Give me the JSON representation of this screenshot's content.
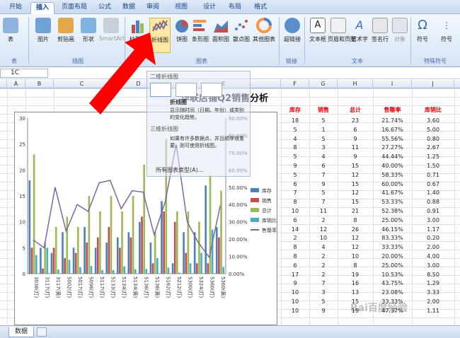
{
  "tabs": [
    "开始",
    "插入",
    "页面布局",
    "公式",
    "数据",
    "审阅",
    "视图",
    "设计",
    "布局",
    "格式"
  ],
  "active_tab": "插入",
  "ribbon": {
    "buttons": [
      {
        "label": "表",
        "icon": "table-icon"
      },
      {
        "label": "图片",
        "icon": "picture-icon"
      },
      {
        "label": "剪贴画",
        "icon": "clipart-icon"
      },
      {
        "label": "形状",
        "icon": "shapes-icon"
      },
      {
        "label": "SmartArt",
        "icon": "smartart-icon"
      },
      {
        "label": "柱形图",
        "icon": "column-chart-icon"
      },
      {
        "label": "折线图",
        "icon": "line-chart-icon"
      },
      {
        "label": "饼图",
        "icon": "pie-chart-icon"
      },
      {
        "label": "条形图",
        "icon": "bar-chart-icon"
      },
      {
        "label": "面积图",
        "icon": "area-chart-icon"
      },
      {
        "label": "散点图",
        "icon": "scatter-chart-icon"
      },
      {
        "label": "其他图表",
        "icon": "other-chart-icon"
      },
      {
        "label": "超链接",
        "icon": "hyperlink-icon"
      },
      {
        "label": "文本框",
        "icon": "textbox-icon"
      },
      {
        "label": "页眉和页脚",
        "icon": "header-footer-icon"
      },
      {
        "label": "艺术字",
        "icon": "wordart-icon"
      },
      {
        "label": "签名行",
        "icon": "signature-icon"
      },
      {
        "label": "对象",
        "icon": "object-icon"
      },
      {
        "label": "符号",
        "icon": "symbol-icon"
      },
      {
        "label": "符号",
        "icon": "more-symbol-icon"
      }
    ],
    "groups": [
      "表",
      "插图",
      "图表",
      "链接",
      "文本",
      "特殊符号"
    ]
  },
  "formula_bar": {
    "cell_ref": "1C"
  },
  "columns": [
    "A",
    "B",
    "C",
    "D",
    "E",
    "F",
    "G",
    "H",
    "I",
    "J"
  ],
  "sheet_title": "华联店铺Q2销售分析",
  "table_headers": [
    "库存",
    "销售",
    "总计",
    "售罄率",
    "库销比"
  ],
  "table_rows": [
    [
      "18",
      "5",
      "23",
      "21.74%",
      "3.60"
    ],
    [
      "5",
      "1",
      "6",
      "16.67%",
      "5.00"
    ],
    [
      "4",
      "5",
      "9",
      "55.56%",
      "0.80"
    ],
    [
      "8",
      "3",
      "11",
      "27.27%",
      "2.67"
    ],
    [
      "5",
      "4",
      "9",
      "44.44%",
      "1.25"
    ],
    [
      "9",
      "6",
      "15",
      "40.00%",
      "1.50"
    ],
    [
      "5",
      "7",
      "12",
      "58.33%",
      "0.71"
    ],
    [
      "6",
      "9",
      "15",
      "60.00%",
      "0.67"
    ],
    [
      "7",
      "5",
      "12",
      "41.67%",
      "1.40"
    ],
    [
      "8",
      "7",
      "15",
      "53.33%",
      "0.88"
    ],
    [
      "10",
      "11",
      "21",
      "52.38%",
      "0.91"
    ],
    [
      "6",
      "2",
      "8",
      "25.00%",
      "3.00"
    ],
    [
      "14",
      "12",
      "26",
      "46.15%",
      "1.17"
    ],
    [
      "2",
      "10",
      "12",
      "83.33%",
      "0.20"
    ],
    [
      "8",
      "4",
      "12",
      "33.33%",
      "2.00"
    ],
    [
      "8",
      "2",
      "10",
      "20.00%",
      "4.00"
    ],
    [
      "6",
      "2",
      "8",
      "25.00%",
      "3.00"
    ],
    [
      "17",
      "2",
      "19",
      "10.53%",
      "8.50"
    ],
    [
      "9",
      "7",
      "16",
      "43.75%",
      "1.29"
    ],
    [
      "10",
      "3",
      "13",
      "23.08%",
      "3.33"
    ],
    [
      "10",
      "5",
      "15",
      "33.33%",
      "2.00"
    ],
    [
      "10",
      "9",
      "19",
      "47.37%",
      "1.11"
    ]
  ],
  "chart_data": {
    "type": "bar",
    "categories": [
      "3036(灯)",
      "3117(灯)",
      "3117(黄)",
      "5002(灯)",
      "5017(灯)",
      "5096(灯)",
      "5117(灯)",
      "5133(灯)",
      "5134(灯)",
      "5134(黄)",
      "5136(灯)",
      "5136(黄)",
      "5162(灯)",
      "5212(灯)",
      "5300(灯)",
      "5324(灯)",
      "5360(灯)",
      "5360(黄)"
    ],
    "series": [
      {
        "name": "库存",
        "color": "#4f81bd",
        "values": [
          18,
          5,
          4,
          8,
          5,
          9,
          5,
          6,
          7,
          8,
          10,
          6,
          14,
          2,
          8,
          8,
          17,
          9
        ]
      },
      {
        "name": "销售",
        "color": "#c0504d",
        "values": [
          5,
          1,
          5,
          3,
          4,
          6,
          7,
          9,
          5,
          7,
          11,
          2,
          12,
          10,
          4,
          2,
          2,
          7
        ]
      },
      {
        "name": "总计",
        "color": "#9bbb59",
        "values": [
          23,
          6,
          9,
          11,
          9,
          15,
          12,
          15,
          12,
          15,
          21,
          8,
          26,
          12,
          12,
          10,
          19,
          16
        ]
      },
      {
        "name": "库销比",
        "color": "#4bacc6",
        "values": [
          3.6,
          5,
          0.8,
          2.67,
          1.25,
          1.5,
          0.71,
          0.67,
          1.4,
          0.88,
          0.91,
          3,
          1.17,
          0.2,
          2,
          4,
          8.5,
          1.29
        ]
      },
      {
        "name": "售罄率",
        "color": "#8064a2",
        "axis": "right",
        "values": [
          21.74,
          16.67,
          55.56,
          27.27,
          44.44,
          40,
          58.33,
          60,
          41.67,
          53.33,
          52.38,
          25,
          46.15,
          83.33,
          33.33,
          20,
          10.53,
          43.75
        ]
      }
    ],
    "y_ticks": [
      "0",
      "5",
      "10",
      "15",
      "20",
      "25",
      "30"
    ],
    "ylim": [
      0,
      30
    ],
    "y2_ticks": [
      "0.00%",
      "10.00%",
      "20.00%",
      "30.00%",
      "40.00%",
      "50.00%",
      "60.00%",
      "70.00%",
      "80.00%",
      "90.00%"
    ],
    "y2lim": [
      0,
      100
    ],
    "legend_position": "right"
  },
  "popup": {
    "title": "二维折线图",
    "item1": "折线图",
    "desc1": "显示随时间（日期、年份）或类别的变化趋势。",
    "item2": "三维折线图",
    "desc2": "如果有许多数据点，并且顺序很重要，则可使用折线图。",
    "all_types": "所有图表类型(A)..."
  },
  "sheet_tab": "数据",
  "watermark": "Bai百度经验",
  "colors": {
    "accent": "#d00000",
    "arrow": "#ff0000"
  }
}
